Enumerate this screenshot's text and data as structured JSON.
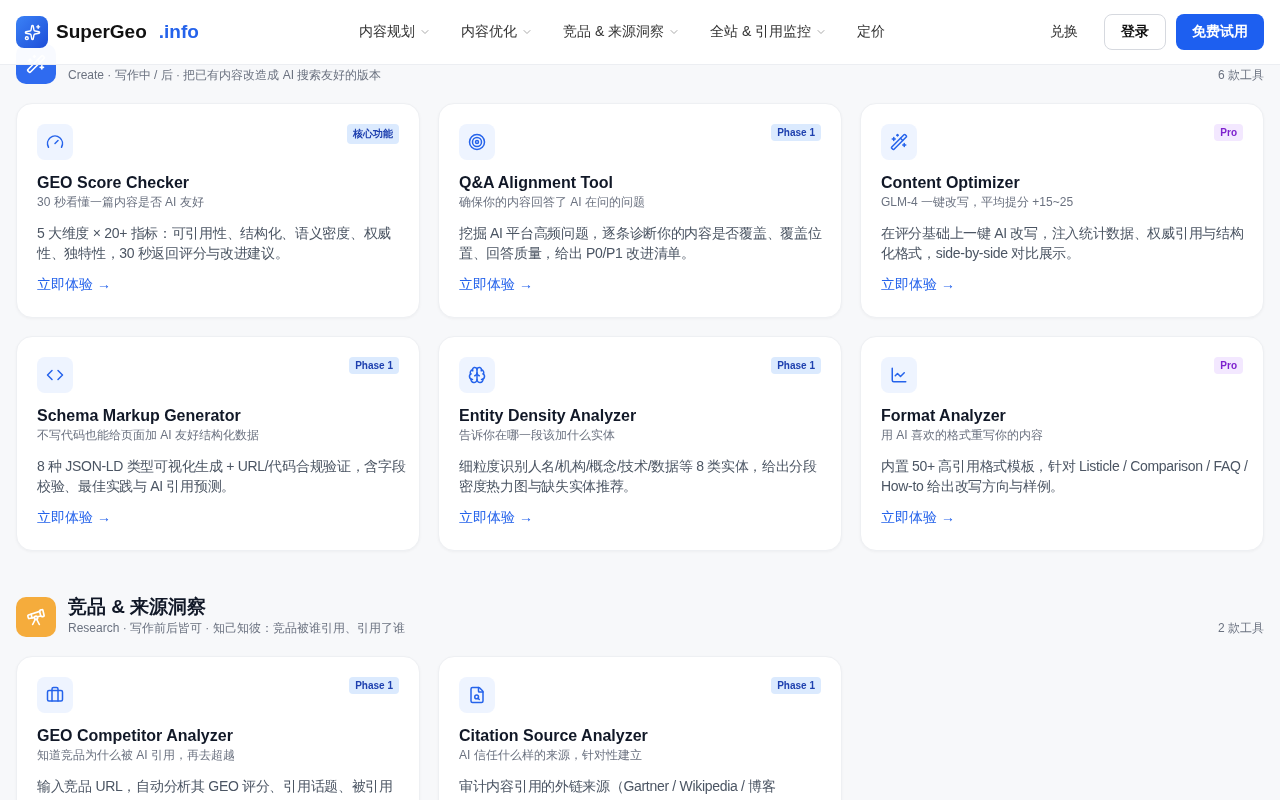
{
  "brand": {
    "name": "SuperGeo",
    "suffix": ".info"
  },
  "nav": [
    {
      "label": "内容规划",
      "has_menu": true
    },
    {
      "label": "内容优化",
      "has_menu": true
    },
    {
      "label": "竞品 & 来源洞察",
      "has_menu": true
    },
    {
      "label": "全站 & 引用监控",
      "has_menu": true
    },
    {
      "label": "定价",
      "has_menu": false
    }
  ],
  "actions": [
    {
      "label": "兑换",
      "kind": "text"
    },
    {
      "label": "登录",
      "kind": "outline"
    },
    {
      "label": "免费试用",
      "kind": "primary"
    }
  ],
  "sections": [
    {
      "color": "#2f6bf0",
      "subtitle": "Create · 写作中 / 后 · 把已有内容改造成 AI 搜索友好的版本",
      "count": "6 款工具",
      "cards": [
        {
          "badge": {
            "label": "核心功能",
            "kind": "core"
          },
          "title": "GEO Score Checker",
          "tagline": "30 秒看懂一篇内容是否 AI 友好",
          "description": "5 大维度 × 20+ 指标：可引用性、结构化、语义密度、权威性、独特性，30 秒返回评分与改进建议。",
          "link": "立即体验 →"
        },
        {
          "badge": {
            "label": "Phase 1",
            "kind": "phase"
          },
          "title": "Q&A Alignment Tool",
          "tagline": "确保你的内容回答了 AI 在问的问题",
          "description": "挖掘 AI 平台高频问题，逐条诊断你的内容是否覆盖、覆盖位置、回答质量，给出 P0/P1 改进清单。",
          "link": "立即体验 →"
        },
        {
          "badge": {
            "label": "Pro",
            "kind": "pro"
          },
          "title": "Content Optimizer",
          "tagline": "GLM-4 一键改写，平均提分 +15~25",
          "description": "在评分基础上一键 AI 改写，注入统计数据、权威引用与结构化格式，side-by-side 对比展示。",
          "link": "立即体验 →"
        },
        {
          "badge": {
            "label": "Phase 1",
            "kind": "phase"
          },
          "title": "Schema Markup Generator",
          "tagline": "不写代码也能给页面加 AI 友好结构化数据",
          "description": "8 种 JSON-LD 类型可视化生成 + URL/代码合规验证，含字段校验、最佳实践与 AI 引用预测。",
          "link": "立即体验 →"
        },
        {
          "badge": {
            "label": "Phase 1",
            "kind": "phase"
          },
          "title": "Entity Density Analyzer",
          "tagline": "告诉你在哪一段该加什么实体",
          "description": "细粒度识别人名/机构/概念/技术/数据等 8 类实体，给出分段密度热力图与缺失实体推荐。",
          "link": "立即体验 →"
        },
        {
          "badge": {
            "label": "Pro",
            "kind": "pro"
          },
          "title": "Format Analyzer",
          "tagline": "用 AI 喜欢的格式重写你的内容",
          "description": "内置 50+ 高引用格式模板，针对 Listicle / Comparison / FAQ / How-to 给出改写方向与样例。",
          "link": "立即体验 →"
        }
      ]
    },
    {
      "color": "#f5ac3c",
      "title": "竞品 & 来源洞察",
      "subtitle": "Research · 写作前后皆可 · 知己知彼：竞品被谁引用、引用了谁",
      "count": "2 款工具",
      "cards": [
        {
          "badge": {
            "label": "Phase 1",
            "kind": "phase"
          },
          "title": "GEO Competitor Analyzer",
          "tagline": "知道竞品为什么被 AI 引用，再去超越",
          "description": "输入竞品 URL，自动分析其 GEO 评分、引用话题、被引用"
        },
        {
          "badge": {
            "label": "Phase 1",
            "kind": "phase"
          },
          "title": "Citation Source Analyzer",
          "tagline": "AI 信任什么样的来源，针对性建立",
          "description": "审计内容引用的外链来源（Gartner / Wikipedia / 博客"
        }
      ]
    }
  ]
}
